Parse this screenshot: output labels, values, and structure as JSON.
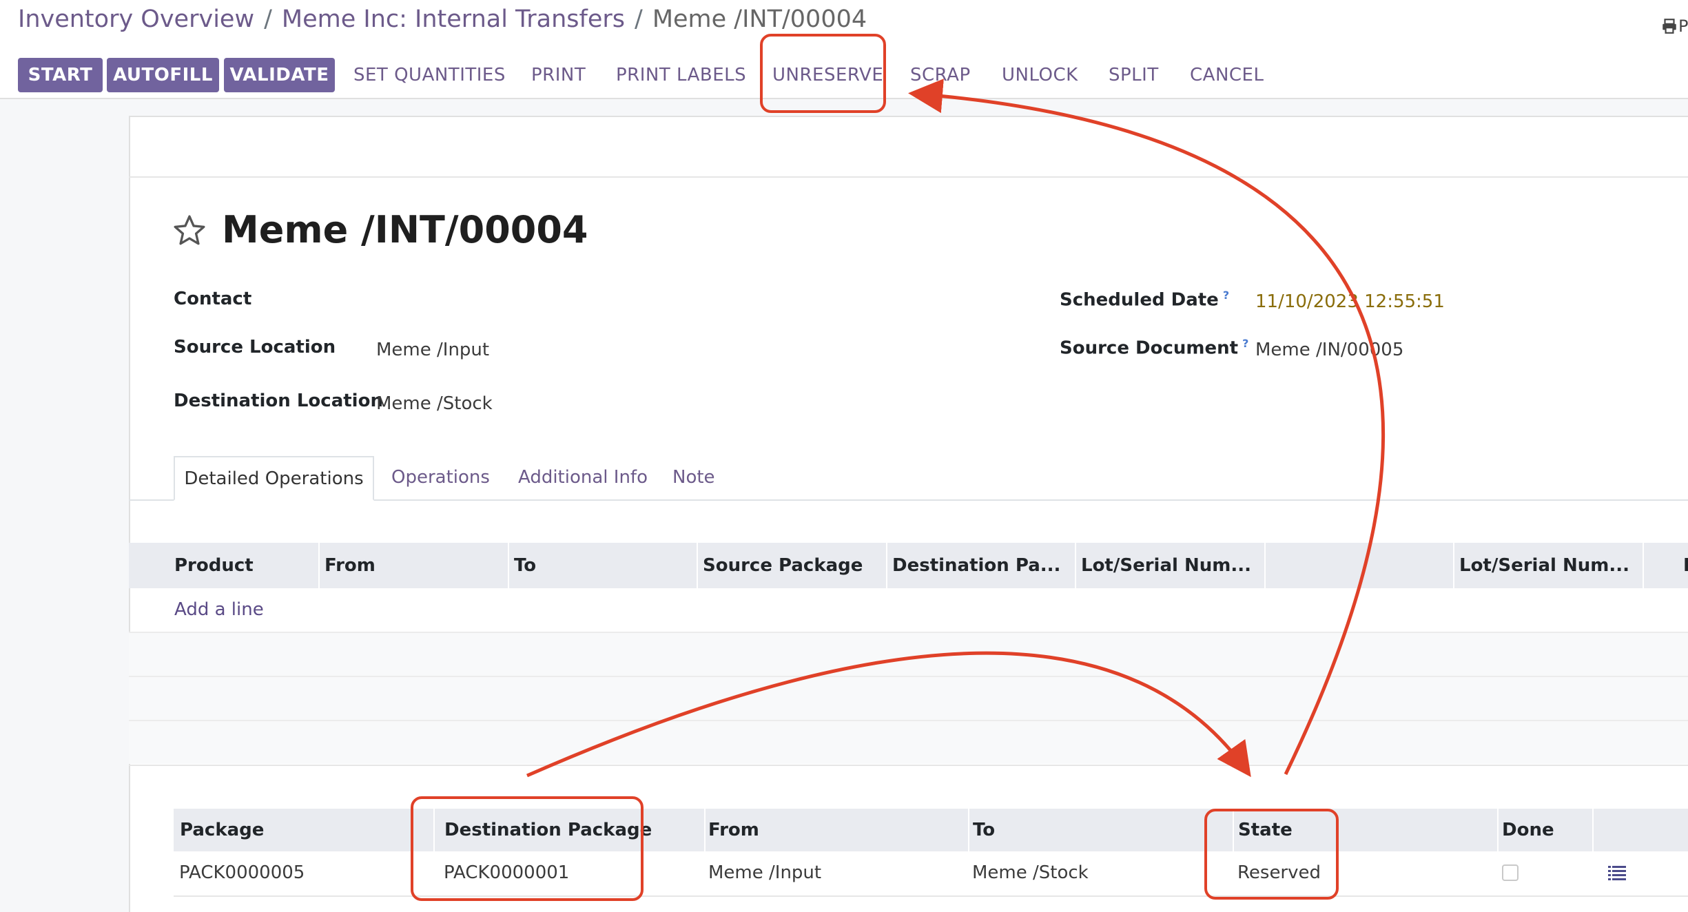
{
  "breadcrumb": {
    "items": [
      "Inventory Overview",
      "Meme Inc: Internal Transfers"
    ],
    "current": "Meme /INT/00004",
    "separator": "/",
    "right_cut_text": "P"
  },
  "actions": {
    "start": "START",
    "autofill": "AUTOFILL",
    "validate": "VALIDATE",
    "set_quantities": "SET QUANTITIES",
    "print": "PRINT",
    "print_labels": "PRINT LABELS",
    "unreserve": "UNRESERVE",
    "scrap": "SCRAP",
    "unlock": "UNLOCK",
    "split": "SPLIT",
    "cancel": "CANCEL"
  },
  "record": {
    "title": "Meme /INT/00004",
    "fields": {
      "contact_label": "Contact",
      "contact_value": "",
      "source_location_label": "Source Location",
      "source_location_value": "Meme /Input",
      "destination_location_label": "Destination Location",
      "destination_location_value": "Meme /Stock",
      "scheduled_date_label": "Scheduled Date",
      "scheduled_date_value": "11/10/2023 12:55:51",
      "source_document_label": "Source Document",
      "source_document_value": "Meme /IN/00005",
      "help_mark": "?"
    }
  },
  "tabs": [
    "Detailed Operations",
    "Operations",
    "Additional Info",
    "Note"
  ],
  "operations_table": {
    "columns": [
      "Product",
      "From",
      "To",
      "Source Package",
      "Destination Pa...",
      "Lot/Serial Num...",
      "",
      "Lot/Serial Num...",
      "F"
    ],
    "add_line": "Add a line"
  },
  "package_table": {
    "columns": [
      "Package",
      "Destination Package",
      "From",
      "To",
      "State",
      "Done"
    ],
    "rows": [
      {
        "package": "PACK0000005",
        "destination_package": "PACK0000001",
        "from": "Meme /Input",
        "to": "Meme /Stock",
        "state": "Reserved",
        "done": false
      }
    ]
  },
  "colors": {
    "primary": "#71639e",
    "link": "#6c5a8a",
    "annotation_red": "#e04128",
    "date_text": "#8a6d0b"
  },
  "icons": [
    "print-icon",
    "star-icon",
    "list-detail-icon"
  ]
}
